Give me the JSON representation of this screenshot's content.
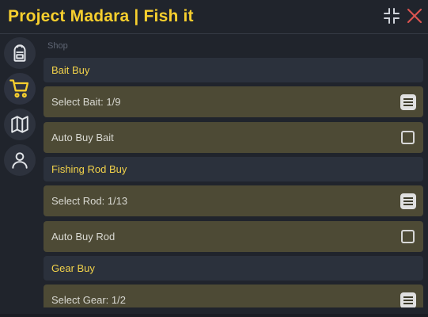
{
  "window": {
    "title": "Project Madara | Fish it"
  },
  "titlebar": {
    "minimize_icon": "collapse-arrows-icon",
    "close_icon": "close-x-icon",
    "close_color": "#d9534f"
  },
  "sidebar": {
    "items": [
      {
        "icon": "backpack-icon",
        "active": false
      },
      {
        "icon": "cart-icon",
        "active": true
      },
      {
        "icon": "map-icon",
        "active": false
      },
      {
        "icon": "user-icon",
        "active": false
      }
    ],
    "accent": "#f7cf2e"
  },
  "shop": {
    "caption": "Shop",
    "bait_header": "Bait Buy",
    "select_bait": "Select Bait: 1/9",
    "auto_buy_bait": "Auto Buy Bait",
    "rod_header": "Fishing Rod Buy",
    "select_rod": "Select Rod: 1/13",
    "auto_buy_rod": "Auto Buy Rod",
    "gear_header": "Gear Buy",
    "select_gear": "Select Gear: 1/2"
  },
  "colors": {
    "title": "#f7cf2e",
    "header_bg": "#2b313c",
    "item_bg": "#4d4a35",
    "window_bg": "#20242c"
  }
}
